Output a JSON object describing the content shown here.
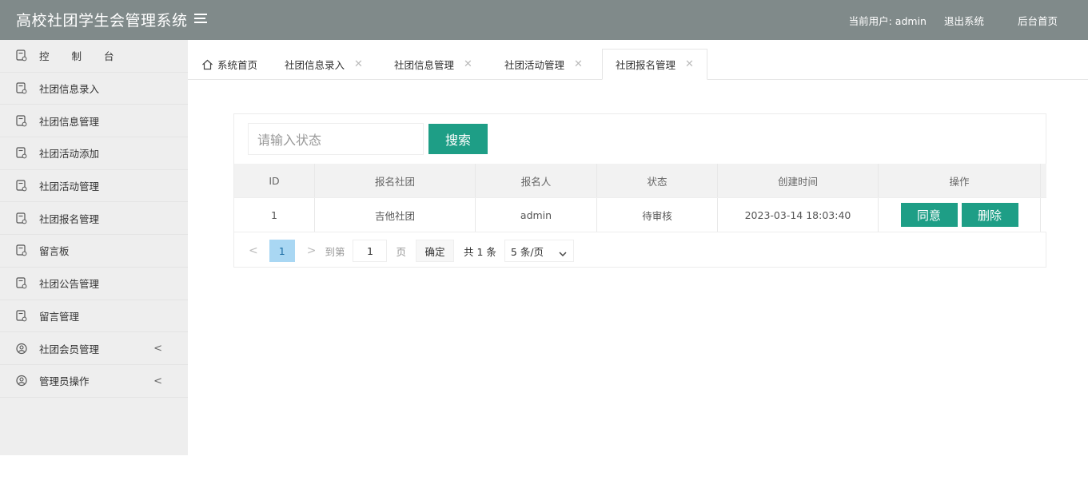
{
  "header": {
    "title": "高校社团学生会管理系统",
    "current_user_label": "当前用户: admin",
    "logout": "退出系统",
    "home": "后台首页"
  },
  "sidebar": {
    "items": [
      {
        "label": "控 制 台",
        "icon": "document-icon"
      },
      {
        "label": "社团信息录入",
        "icon": "document-icon"
      },
      {
        "label": "社团信息管理",
        "icon": "document-icon"
      },
      {
        "label": "社团活动添加",
        "icon": "document-icon"
      },
      {
        "label": "社团活动管理",
        "icon": "document-icon"
      },
      {
        "label": "社团报名管理",
        "icon": "document-icon"
      },
      {
        "label": "留言板",
        "icon": "document-icon"
      },
      {
        "label": "社团公告管理",
        "icon": "document-icon"
      },
      {
        "label": "留言管理",
        "icon": "document-icon"
      },
      {
        "label": "社团会员管理",
        "icon": "user-circle-icon"
      },
      {
        "label": "管理员操作",
        "icon": "user-circle-icon"
      }
    ]
  },
  "tabs": [
    {
      "label": "系统首页"
    },
    {
      "label": "社团信息录入"
    },
    {
      "label": "社团信息管理"
    },
    {
      "label": "社团活动管理"
    },
    {
      "label": "社团报名管理"
    }
  ],
  "search": {
    "placeholder": "请输入状态",
    "button": "搜索"
  },
  "table": {
    "headers": [
      "ID",
      "报名社团",
      "报名人",
      "状态",
      "创建时间",
      "操作"
    ],
    "rows": [
      {
        "id": "1",
        "club": "吉他社团",
        "applicant": "admin",
        "status": "待审核",
        "created": "2023-03-14 18:03:40",
        "agree": "同意",
        "delete": "删除"
      }
    ]
  },
  "pager": {
    "current_page": "1",
    "goto_label": "到第",
    "page_input": "1",
    "page_unit": "页",
    "confirm": "确定",
    "total": "共 1 条",
    "page_size": "5 条/页"
  },
  "colors": {
    "header_bg": "#808a8a",
    "accent": "#1e9e86",
    "sidebar_bg": "#eeeeee",
    "page_active": "#a9d7f3"
  }
}
